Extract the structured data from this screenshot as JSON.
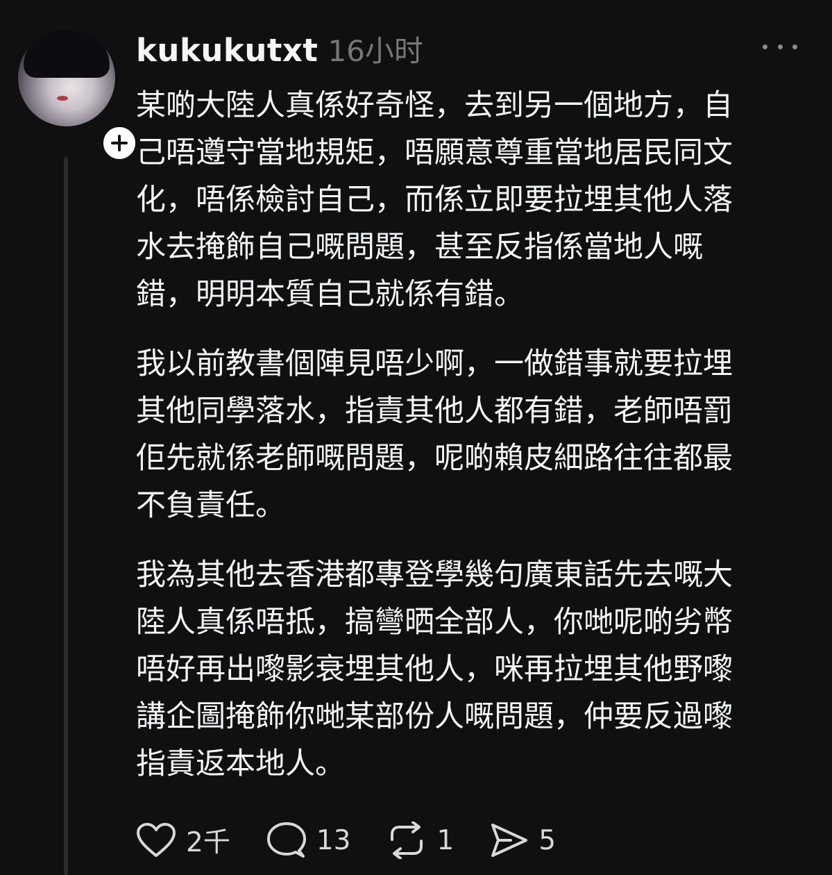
{
  "post": {
    "username": "kukukutxt",
    "timestamp": "16小时",
    "paragraphs": [
      "某啲大陸人真係好奇怪，去到另一個地方，自\n己唔遵守當地規矩，唔願意尊重當地居民同文\n化，唔係檢討自己，而係立即要拉埋其他人落\n水去掩飾自己嘅問題，甚至反指係當地人嘅\n錯，￼明明本質￼自己就係有錯。",
      "我以前教書個陣見唔少啊，一做錯事就要拉埋\n其他同學落水，指責其他人都有錯，老師唔罰\n佢先就係老師嘅問題，呢啲賴皮細路往往都最\n不負責任。",
      "我為其他去香港都專登學幾句廣東話先去嘅大\n陸人真係唔抵，搞彎晒全部人，你哋呢啲劣幣\n唔好再出嚟影衰埋其他人，咪再拉埋其他野嚟\n講企圖掩飾你哋某部份人嘅問題，仲要反過嚟\n指責返本地人。"
    ]
  },
  "actions": {
    "likes": "2千",
    "comments": "13",
    "reposts": "1",
    "shares": "5"
  },
  "icons": {
    "follow": "plus-icon",
    "more": "more-dots-icon",
    "like": "heart-icon",
    "comment": "comment-bubble-icon",
    "repost": "repost-icon",
    "share": "send-icon"
  },
  "colors": {
    "background": "#101010",
    "text": "#f3f5f7",
    "muted": "#777777"
  }
}
